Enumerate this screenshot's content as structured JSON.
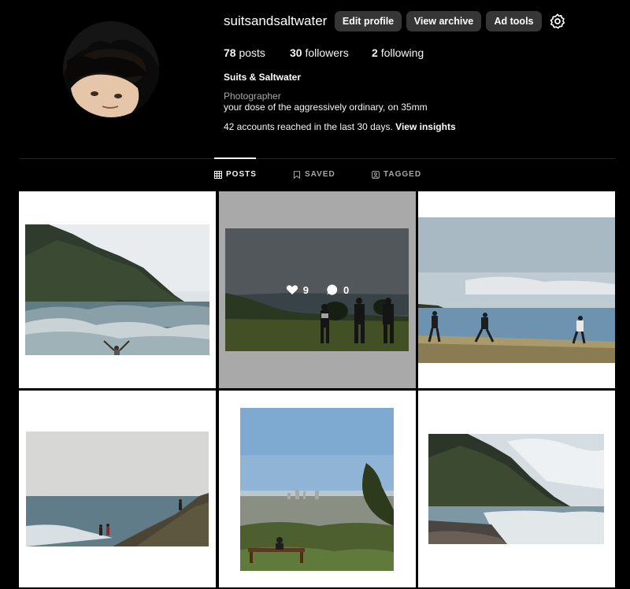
{
  "profile": {
    "username": "suitsandsaltwater",
    "full_name": "Suits & Saltwater",
    "category": "Photographer",
    "bio": "your dose of the aggressively ordinary, on 35mm",
    "insights_text": "42 accounts reached in the last 30 days.",
    "insights_link": "View insights"
  },
  "buttons": {
    "edit_profile": "Edit profile",
    "view_archive": "View archive",
    "ad_tools": "Ad tools"
  },
  "stats": {
    "posts_count": "78",
    "posts_label": "posts",
    "followers_count": "30",
    "followers_label": "followers",
    "following_count": "2",
    "following_label": "following"
  },
  "tabs": [
    {
      "label": "POSTS",
      "icon": "grid-icon",
      "active": true
    },
    {
      "label": "SAVED",
      "icon": "bookmark-icon",
      "active": false
    },
    {
      "label": "TAGGED",
      "icon": "tag-person-icon",
      "active": false
    }
  ],
  "hover_post": {
    "likes": "9",
    "comments": "0"
  },
  "posts": [
    {
      "subject": "coastal cliff with waves and person with raised arms"
    },
    {
      "subject": "three hikers on grassy headland above ocean"
    },
    {
      "subject": "people walking along clifftop path by the sea"
    },
    {
      "subject": "two people on rocky shoreline under overcast sky"
    },
    {
      "subject": "person on bench overlooking city and coastline"
    },
    {
      "subject": "steep headland and rocky beach with surf"
    }
  ],
  "colors": {
    "background": "#000000",
    "button_bg": "#363636",
    "muted_text": "#a8a8a8",
    "divider": "#262626"
  }
}
